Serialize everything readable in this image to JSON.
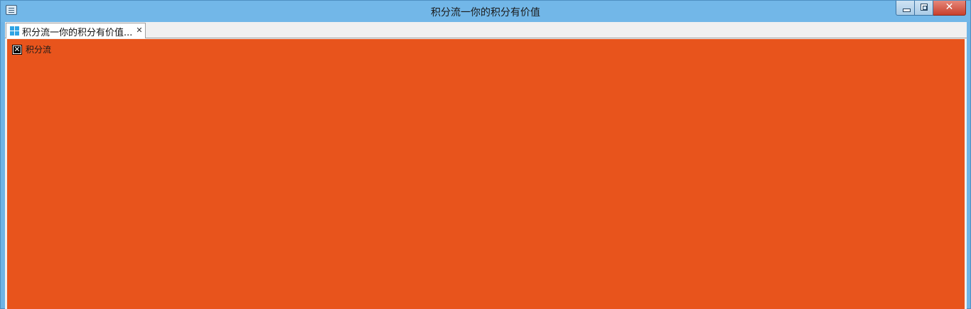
{
  "window": {
    "title": "积分流一你的积分有价值"
  },
  "tabs": [
    {
      "label": "积分流一你的积分有价值...",
      "icon": "windows-logo-icon"
    }
  ],
  "content": {
    "image_alt": "积分流",
    "background": "#e8541c"
  },
  "colors": {
    "titlebar": "#72b7e8",
    "close_button": "#c8402c",
    "accent": "#2fa4e4"
  }
}
